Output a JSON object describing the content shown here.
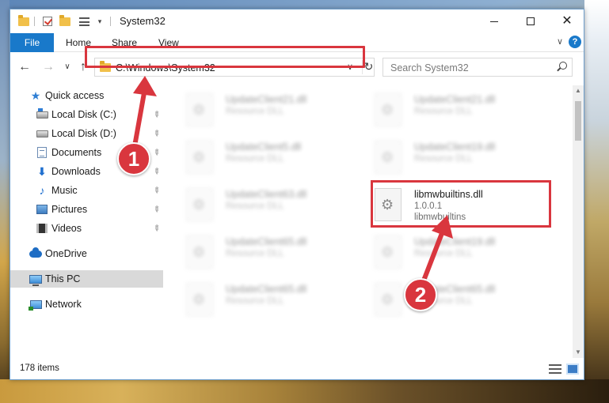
{
  "window": {
    "title": "System32",
    "minimize": "—",
    "maximize": "☐",
    "close": "✕"
  },
  "ribbon": {
    "file_tab": "File",
    "tabs": [
      "Home",
      "Share",
      "View"
    ],
    "expand": "∨",
    "help": "?"
  },
  "nav": {
    "back": "←",
    "forward": "→",
    "recent": "∨",
    "up": "↑",
    "address": "C:\\Windows\\System32",
    "address_dropdown": "∨",
    "refresh": "↻",
    "search_placeholder": "Search System32"
  },
  "sidebar": {
    "quick_access": "Quick access",
    "items": [
      {
        "label": "Local Disk (C:)",
        "pinned": true
      },
      {
        "label": "Local Disk (D:)",
        "pinned": true
      },
      {
        "label": "Documents",
        "pinned": true
      },
      {
        "label": "Downloads",
        "pinned": true
      },
      {
        "label": "Music",
        "pinned": true
      },
      {
        "label": "Pictures",
        "pinned": true
      },
      {
        "label": "Videos",
        "pinned": true
      }
    ],
    "onedrive": "OneDrive",
    "this_pc": "This PC",
    "network": "Network",
    "pin_glyph": "📌"
  },
  "files": {
    "left_column": [
      {
        "name": "UpdateClient21.dll",
        "desc": "Resource DLL"
      },
      {
        "name": "UpdateClient5.dll",
        "desc": "Resource DLL"
      },
      {
        "name": "UpdateClient63.dll",
        "desc": "Resource DLL"
      },
      {
        "name": "UpdateClient65.dll",
        "desc": "Resource DLL"
      },
      {
        "name": "UpdateClient65.dll",
        "desc": "Resource DLL"
      }
    ],
    "right_column": [
      {
        "name": "UpdateClient21.dll",
        "desc": "Resource DLL"
      },
      {
        "name": "UpdateClient19.dll",
        "desc": "Resource DLL"
      },
      {
        "name": "libmwbuiltins.dll",
        "desc": "1.0.0.1",
        "sub": "libmwbuiltins"
      },
      {
        "name": "UpdateClient19.dll",
        "desc": "Resource DLL"
      },
      {
        "name": "UpdateClient65.dll",
        "desc": "Resource DLL"
      }
    ]
  },
  "status": {
    "item_count": "178 items"
  },
  "callouts": {
    "step1": "1",
    "step2": "2",
    "color": "#d9363e"
  },
  "colors": {
    "accent": "#1979ca",
    "highlight": "#d9363e",
    "selected_bg": "#d9d9d9"
  }
}
